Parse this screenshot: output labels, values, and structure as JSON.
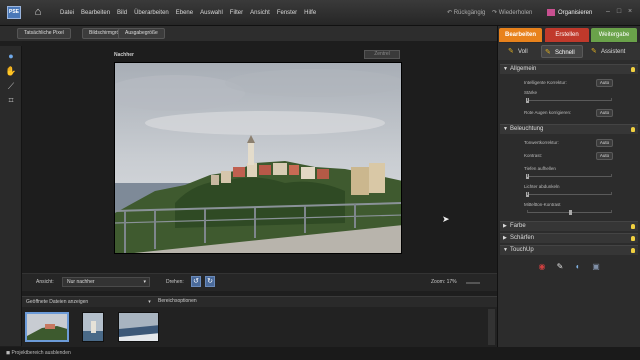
{
  "app": {
    "logo_text": "PSE"
  },
  "menu": [
    "Datei",
    "Bearbeiten",
    "Bild",
    "Überarbeiten",
    "Ebene",
    "Auswahl",
    "Filter",
    "Ansicht",
    "Fenster",
    "Hilfe"
  ],
  "header": {
    "undo": "Rückgängig",
    "redo": "Wiederholen",
    "organizer": "Organisieren"
  },
  "options": {
    "actual_pixels": "Tatsächliche Pixel",
    "fit_screen": "Bildschirmgröße",
    "print_size": "Ausgabegröße"
  },
  "canvas": {
    "after_label": "Nachher",
    "zoom_box": "Zentrel"
  },
  "viewbar": {
    "view_label": "Ansicht:",
    "view_value": "Nur nachher",
    "rotate_label": "Drehen:",
    "zoom_label": "Zoom:",
    "zoom_value": "17%"
  },
  "bin": {
    "select_label": "Geöffnete Dateien anzeigen",
    "options_label": "Bereichsoptionen"
  },
  "status": {
    "text": "Projektbereich ausblenden"
  },
  "modes": {
    "edit": "Bearbeiten",
    "create": "Erstellen",
    "share": "Weitergabe"
  },
  "subtabs": {
    "full": "Voll",
    "quick": "Schnell",
    "guided": "Assistent"
  },
  "panels": {
    "general": {
      "title": "Allgemein",
      "smart_fix": "Intelligente Korrektur:",
      "strength": "Stärke",
      "red_eye": "Rote Augen korrigieren:",
      "auto": "Auto",
      "strength_level": 0.0
    },
    "lighting": {
      "title": "Beleuchtung",
      "levels": "Tonwertkorrektur:",
      "contrast": "Kontrast:",
      "shadows": "Tiefen aufhellen",
      "highlights": "Lichter abdunkeln",
      "midtone": "Mitteltton-Kontrast",
      "auto": "Auto",
      "shadows_level": 0.0,
      "highlights_level": 0.0,
      "midtone_level": 0.5
    },
    "color": {
      "title": "Farbe"
    },
    "sharpen": {
      "title": "Schärfen"
    },
    "touchup": {
      "title": "TouchUp"
    }
  }
}
